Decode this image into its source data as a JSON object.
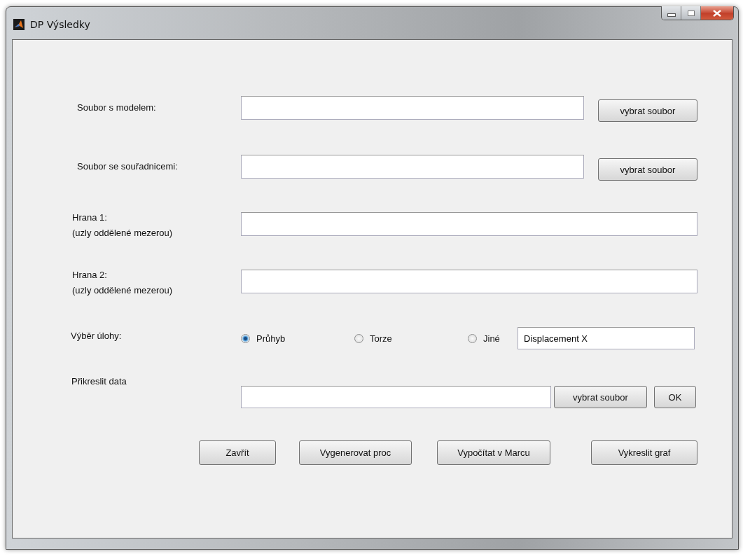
{
  "window": {
    "title": "DP Výsledky"
  },
  "rows": [
    {
      "kind": "file",
      "label": [
        "Soubor s modelem:"
      ],
      "button": "vybrat soubor"
    },
    {
      "kind": "file",
      "label": [
        "Soubor se souřadnicemi:"
      ],
      "button": "vybrat soubor"
    },
    {
      "kind": "edge",
      "label": [
        "Hrana 1:",
        "(uzly oddělené mezerou)"
      ]
    },
    {
      "kind": "edge",
      "label": [
        "Hrana 2:",
        "(uzly oddělené mezerou)"
      ]
    },
    {
      "kind": "choice",
      "label": [
        "Výběr úlohy:"
      ],
      "options": [
        {
          "label": "Průhyb",
          "selected": true
        },
        {
          "label": "Torze",
          "selected": false
        },
        {
          "label": "Jiné",
          "selected": false
        }
      ],
      "value": "Displacement X"
    },
    {
      "kind": "plot",
      "label": [
        "Přikreslit data"
      ],
      "buttons": [
        "vybrat soubor",
        "OK"
      ]
    }
  ],
  "actions": [
    "Zavřít",
    "Vygenerovat proc",
    "Vypočítat v Marcu",
    "Vykreslit graf"
  ]
}
